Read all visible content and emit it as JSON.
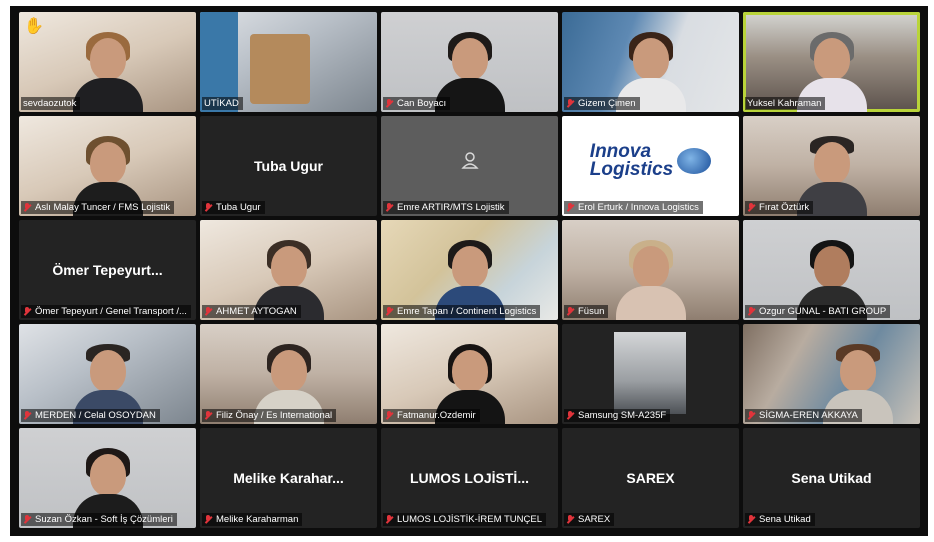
{
  "participants": [
    {
      "label": "sevdaozutok",
      "muted": false,
      "display_name": "",
      "kind": "camera",
      "raised_hand": true
    },
    {
      "label": "UTİKAD",
      "muted": false,
      "display_name": "",
      "kind": "camera"
    },
    {
      "label": "Can Boyacı",
      "muted": true,
      "display_name": "",
      "kind": "camera"
    },
    {
      "label": "Gizem Çimen",
      "muted": true,
      "display_name": "",
      "kind": "camera"
    },
    {
      "label": "Yuksel Kahraman",
      "muted": false,
      "display_name": "",
      "kind": "camera",
      "active_speaker": true
    },
    {
      "label": "Aslı Malay Tuncer / FMS Lojistik",
      "muted": true,
      "display_name": "",
      "kind": "camera"
    },
    {
      "label": "Tuba Ugur",
      "muted": true,
      "display_name": "Tuba Ugur",
      "kind": "name"
    },
    {
      "label": "Emre ARTIR/MTS Lojistik",
      "muted": true,
      "display_name": "",
      "kind": "avatar"
    },
    {
      "label": "Erol Erturk / Innova Logistics",
      "muted": true,
      "display_name": "",
      "kind": "logo",
      "logo_line1": "Innova",
      "logo_line2": "Logistics"
    },
    {
      "label": "Fırat Öztürk",
      "muted": true,
      "display_name": "",
      "kind": "camera"
    },
    {
      "label": "Ömer Tepeyurt / Genel Transport /...",
      "muted": true,
      "display_name": "Ömer Tepeyurt...",
      "kind": "name"
    },
    {
      "label": "AHMET AYTOGAN",
      "muted": true,
      "display_name": "",
      "kind": "camera"
    },
    {
      "label": "Emre Tapan / Continent Logistics",
      "muted": true,
      "display_name": "",
      "kind": "camera"
    },
    {
      "label": "Füsun",
      "muted": true,
      "display_name": "",
      "kind": "camera"
    },
    {
      "label": "Ozgur GUNAL - BATI GROUP",
      "muted": true,
      "display_name": "",
      "kind": "camera"
    },
    {
      "label": "MERDEN / Celal OSOYDAN",
      "muted": true,
      "display_name": "",
      "kind": "camera"
    },
    {
      "label": "Filiz Önay / Es International",
      "muted": true,
      "display_name": "",
      "kind": "camera"
    },
    {
      "label": "Fatmanur.Ozdemir",
      "muted": true,
      "display_name": "",
      "kind": "camera"
    },
    {
      "label": "Samsung SM-A235F",
      "muted": true,
      "display_name": "",
      "kind": "camera"
    },
    {
      "label": "SİGMA-EREN AKKAYA",
      "muted": true,
      "display_name": "",
      "kind": "camera"
    },
    {
      "label": "Suzan Özkan - Soft İş Çözümleri",
      "muted": true,
      "display_name": "",
      "kind": "camera"
    },
    {
      "label": "Melike Karaharman",
      "muted": true,
      "display_name": "Melike Karahar...",
      "kind": "name"
    },
    {
      "label": "LUMOS LOJİSTİK-İREM TUNÇEL",
      "muted": true,
      "display_name": "LUMOS LOJİSTİ...",
      "kind": "name"
    },
    {
      "label": "SAREX",
      "muted": true,
      "display_name": "SAREX",
      "kind": "name"
    },
    {
      "label": "Sena Utikad",
      "muted": true,
      "display_name": "Sena Utikad",
      "kind": "name"
    }
  ],
  "colors": {
    "active_speaker_border": "#b9d43a",
    "muted_icon": "#e0343b"
  }
}
